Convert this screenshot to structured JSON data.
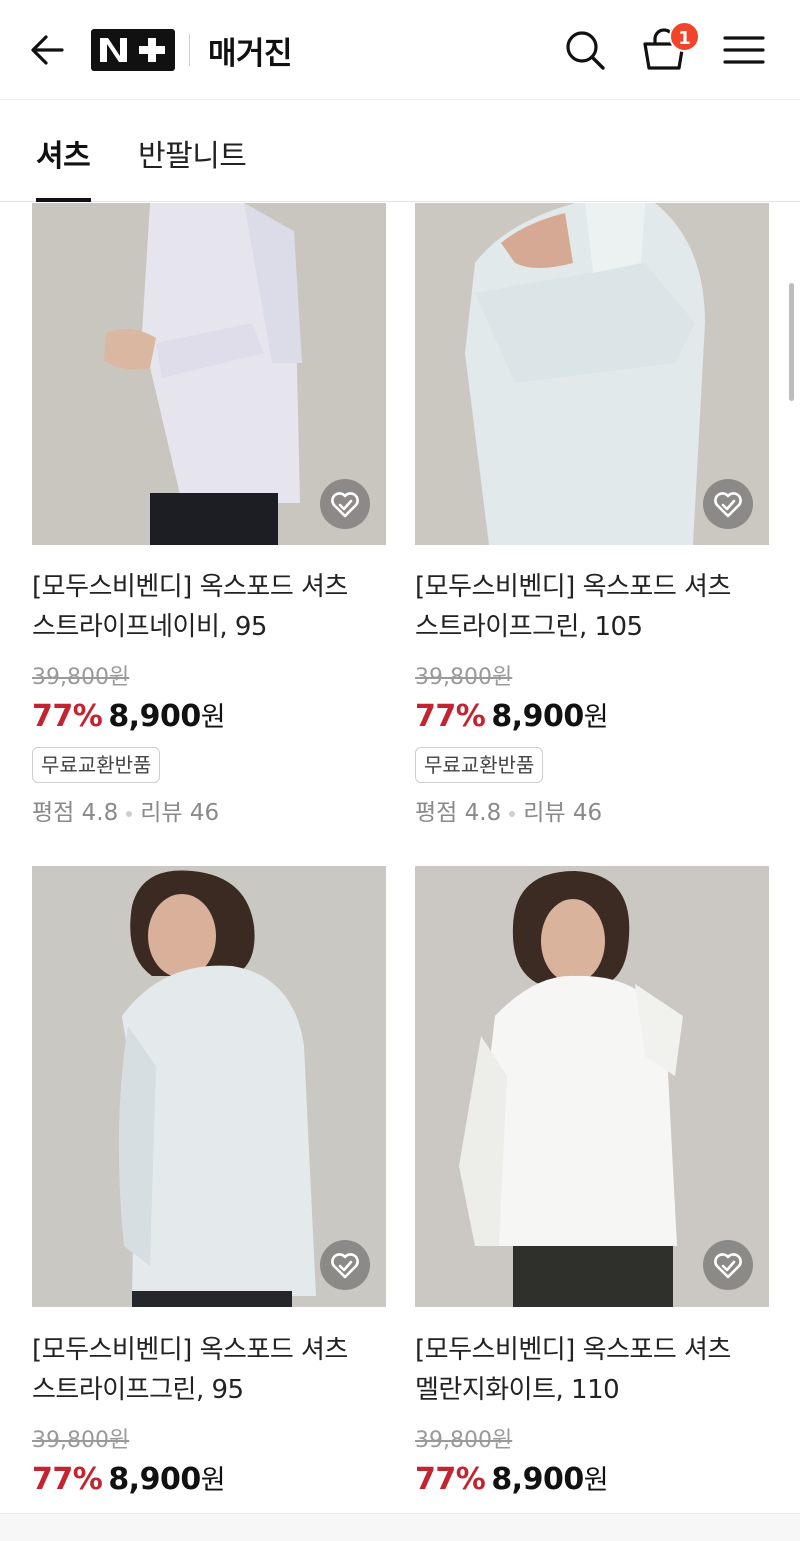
{
  "header": {
    "logo_text": "N+",
    "title": "매거진",
    "cart_count": "1",
    "icons": {
      "back": "arrow-left-icon",
      "search": "search-icon",
      "cart": "shopping-bag-icon",
      "menu": "hamburger-menu-icon"
    }
  },
  "tabs": [
    {
      "label": "셔츠",
      "active": true
    },
    {
      "label": "반팔니트",
      "active": false
    }
  ],
  "products": [
    {
      "name_line1": "[모두스비벤디] 옥스포드 셔츠",
      "name_line2": "스트라이프네이비, 95",
      "original_price": "39,800원",
      "discount": "77%",
      "price": "8,900",
      "currency": "원",
      "tag": "무료교환반품",
      "rating_label": "평점 4.8",
      "review_label": "리뷰 46"
    },
    {
      "name_line1": "[모두스비벤디] 옥스포드 셔츠",
      "name_line2": "스트라이프그린, 105",
      "original_price": "39,800원",
      "discount": "77%",
      "price": "8,900",
      "currency": "원",
      "tag": "무료교환반품",
      "rating_label": "평점 4.8",
      "review_label": "리뷰 46"
    },
    {
      "name_line1": "[모두스비벤디] 옥스포드 셔츠",
      "name_line2": "스트라이프그린, 95",
      "original_price": "39,800원",
      "discount": "77%",
      "price": "8,900",
      "currency": "원"
    },
    {
      "name_line1": "[모두스비벤디] 옥스포드 셔츠",
      "name_line2": "멜란지화이트, 110",
      "original_price": "39,800원",
      "discount": "77%",
      "price": "8,900",
      "currency": "원"
    }
  ],
  "colors": {
    "discount": "#c3242f",
    "badge": "#f0452b",
    "text": "#111111",
    "muted": "#9a9a9a"
  }
}
